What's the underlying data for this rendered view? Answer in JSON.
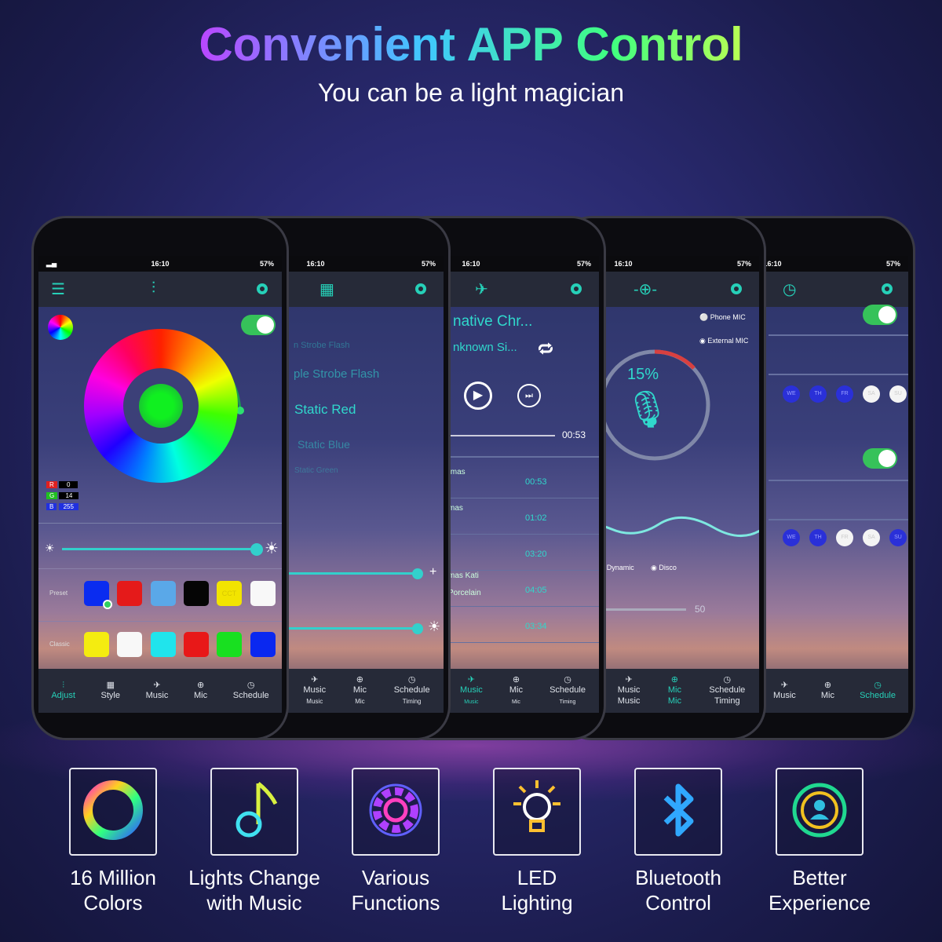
{
  "header": {
    "title": "Convenient APP Control",
    "subtitle": "You can be a light magician"
  },
  "status": {
    "time": "16:10",
    "battery": "57%"
  },
  "accent_color": "#26d0b8",
  "phone_adjust": {
    "rgb": {
      "r_label": "R",
      "r": "0",
      "g_label": "G",
      "g": "14",
      "b_label": "B",
      "b": "255"
    },
    "power_on": true,
    "preset_label": "Preset",
    "classic_label": "Classic",
    "cct_label": "CCT",
    "preset_colors": [
      "#0a2cf0",
      "#e51a1a",
      "#5aa8e8",
      "#050505",
      "#f2e400",
      "#f8f8f8"
    ],
    "classic_colors": [
      "#f4ec10",
      "#f8f8f8",
      "#20e4ec",
      "#e81818",
      "#18e020",
      "#0a28f0"
    ],
    "nav": [
      "Adjust",
      "Style",
      "Music",
      "Mic",
      "Schedule"
    ]
  },
  "phone_style": {
    "modes": [
      "n Strobe Flash",
      "ple Strobe Flash",
      "Static Red",
      "Static Blue",
      "Static Green"
    ],
    "nav": [
      {
        "label": "Music",
        "sub": "Music"
      },
      {
        "label": "Mic",
        "sub": "Mic"
      },
      {
        "label": "Schedule",
        "sub": "Timing"
      }
    ]
  },
  "phone_music": {
    "song": "native Chr...",
    "artist": "nknown Si...",
    "elapsed": "00:53",
    "tracks": [
      {
        "name": "tmas",
        "time": "00:53"
      },
      {
        "name": "mas",
        "time": "01:02"
      },
      {
        "name": "mas Kati",
        "time": "03:20"
      },
      {
        "name": "Porcelain",
        "time": "04:05"
      },
      {
        "name": "",
        "time": "03:34"
      }
    ],
    "nav": [
      {
        "label": "Music",
        "sub": "Music"
      },
      {
        "label": "Mic",
        "sub": "Mic"
      },
      {
        "label": "Schedule",
        "sub": "Timing"
      }
    ]
  },
  "phone_mic": {
    "phone_mic": "Phone MIC",
    "external_mic": "External MIC",
    "level": "15%",
    "mode_dynamic": "Dynamic",
    "mode_disco": "Disco",
    "sensitivity": "50",
    "nav": [
      {
        "label": "Music",
        "sub": "Music"
      },
      {
        "label": "Mic",
        "sub": "Mic"
      },
      {
        "label": "Schedule",
        "sub": "Timing"
      }
    ]
  },
  "phone_schedule": {
    "days1": [
      "WE",
      "TH",
      "FR",
      "SA",
      "SU"
    ],
    "days2": [
      "WE",
      "TH",
      "FR",
      "SA",
      "SU"
    ],
    "nav": [
      "Music",
      "Mic",
      "Schedule"
    ]
  },
  "features": [
    {
      "icon": "color-ring-icon",
      "line1": "16 Million",
      "line2": "Colors"
    },
    {
      "icon": "music-note-icon",
      "line1": "Lights Change",
      "line2": "with Music"
    },
    {
      "icon": "gear-icon",
      "line1": "Various",
      "line2": "Functions"
    },
    {
      "icon": "light-bulb-icon",
      "line1": "LED",
      "line2": "Lighting"
    },
    {
      "icon": "bluetooth-icon",
      "line1": "Bluetooth",
      "line2": "Control"
    },
    {
      "icon": "user-experience-icon",
      "line1": "Better",
      "line2": "Experience"
    }
  ]
}
